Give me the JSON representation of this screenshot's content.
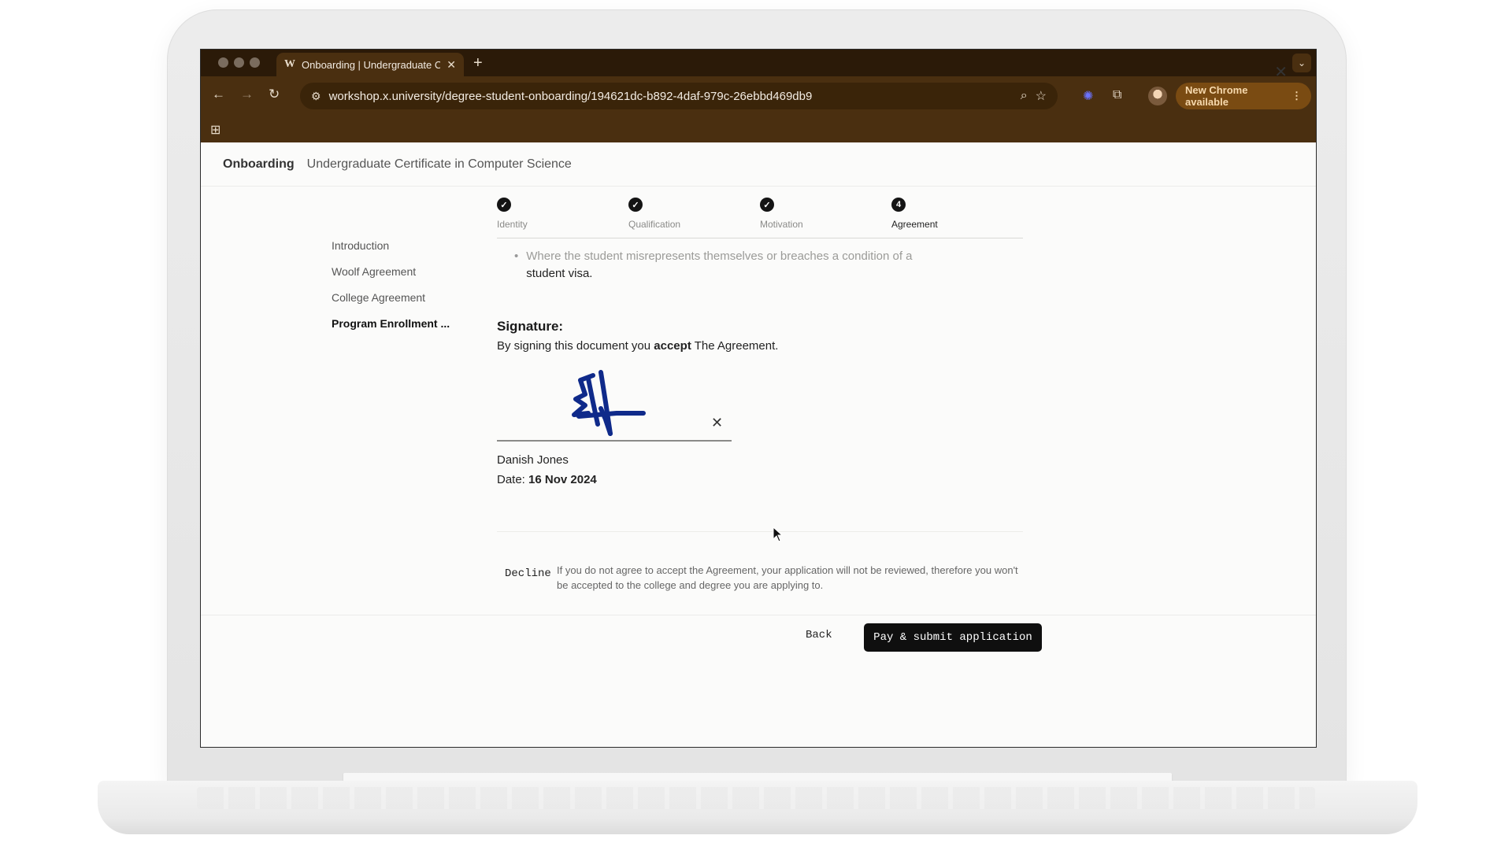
{
  "browser": {
    "tab_title": "Onboarding | Undergraduate C",
    "tab_favicon": "W",
    "new_tab_symbol": "+",
    "url": "workshop.x.university/degree-student-onboarding/194621dc-b892-4daf-979c-26ebbd469db9",
    "update_label": "New Chrome available",
    "icons": {
      "back": "back-arrow-icon",
      "forward": "forward-arrow-icon",
      "reload": "reload-icon",
      "site_settings": "tune-icon",
      "zoom": "zoom-icon",
      "bookmark": "star-icon",
      "extensions": "puzzle-icon",
      "apps": "apps-grid-icon"
    },
    "colors": {
      "frame": "#4a2f10",
      "tabstrip": "#2b1a08",
      "update_chip": "#7a4b12"
    }
  },
  "header": {
    "brand": "Onboarding",
    "course": "Undergraduate Certificate in Computer Science"
  },
  "sidebar": {
    "items": [
      {
        "label": "Introduction",
        "active": false
      },
      {
        "label": "Woolf Agreement",
        "active": false
      },
      {
        "label": "College Agreement",
        "active": false
      },
      {
        "label": "Program Enrollment ...",
        "active": true
      }
    ]
  },
  "stepper": {
    "steps": [
      {
        "label": "Identity",
        "state": "done",
        "marker": "✓"
      },
      {
        "label": "Qualification",
        "state": "done",
        "marker": "✓"
      },
      {
        "label": "Motivation",
        "state": "done",
        "marker": "✓"
      },
      {
        "label": "Agreement",
        "state": "current",
        "marker": "4"
      }
    ]
  },
  "agreement": {
    "bullet_faded": "Where the student misrepresents themselves or breaches a condition of a",
    "bullet_solid": "student visa."
  },
  "signature": {
    "heading": "Signature:",
    "terms_prefix": "By signing this document you ",
    "terms_bold": "accept",
    "terms_suffix": " The Agreement.",
    "signer_name": "Danish Jones",
    "date_label": "Date: ",
    "date_value": "16 Nov 2024",
    "ink_color": "#0f2a8a"
  },
  "decline": {
    "button_label": "Decline",
    "note": "If you do not agree to accept the Agreement, your application will not be reviewed, therefore you won't be accepted to the college and degree you are applying to."
  },
  "footer": {
    "back_label": "Back",
    "submit_label": "Pay & submit application"
  }
}
